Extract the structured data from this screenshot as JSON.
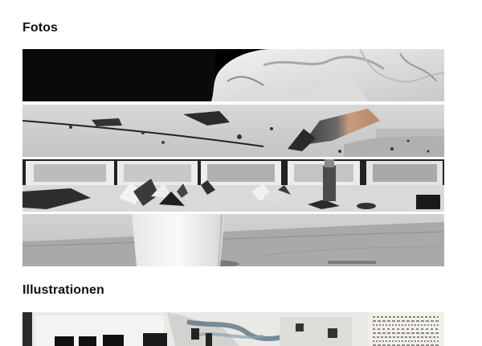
{
  "sections": {
    "photos": {
      "title": "Fotos"
    },
    "illustrations": {
      "title": "Illustrationen"
    }
  },
  "photos": [
    {
      "subject": "white-fabric-on-black"
    },
    {
      "subject": "pencil-shavings-on-concrete"
    },
    {
      "subject": "folded-paper-objects-and-frames"
    },
    {
      "subject": "white-cup-on-concrete-floor"
    }
  ],
  "illustrations": [
    {
      "subject": "newspaper-collage"
    }
  ]
}
